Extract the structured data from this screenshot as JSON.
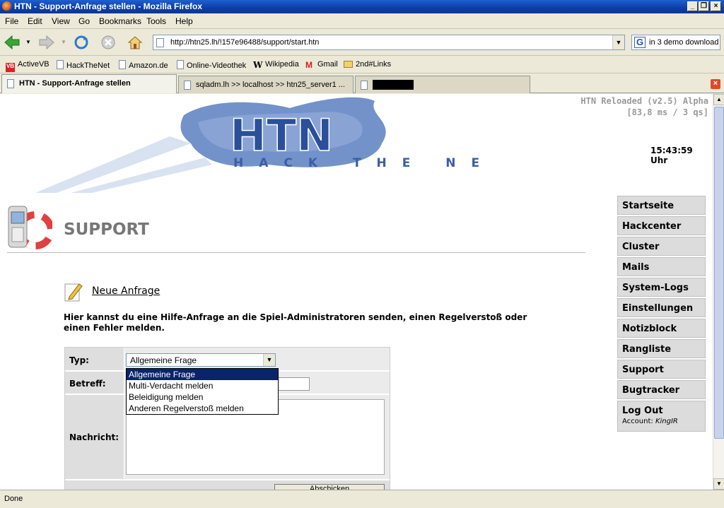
{
  "window": {
    "title": "HTN - Support-Anfrage stellen - Mozilla Firefox"
  },
  "menu": [
    "File",
    "Edit",
    "View",
    "Go",
    "Bookmarks",
    "Tools",
    "Help"
  ],
  "nav": {
    "url": "http://htn25.lh/!157e96488/support/start.htn",
    "search": "in 3 demo download"
  },
  "bookmarks": [
    "ActiveVB",
    "HackTheNet",
    "Amazon.de",
    "Online-Videothek",
    "Wikipedia",
    "Gmail",
    "2nd#Links"
  ],
  "tabs": [
    "HTN - Support-Anfrage stellen",
    "sqladm.lh >> localhost >> htn25_server1 ...",
    ""
  ],
  "page": {
    "logo_text": "HTN",
    "logo_sub": "HACK THE NET",
    "version": "HTN Reloaded (v2.5) Alpha",
    "timing": "[83,8 ms / 3 qs]",
    "clock": "15:43:59 Uhr",
    "heading": "SUPPORT",
    "new_request": "Neue Anfrage",
    "intro": "Hier kannst du eine Hilfe-Anfrage an die Spiel-Administratoren senden, einen Regelverstoß oder einen Fehler melden.",
    "form": {
      "typ_label": "Typ:",
      "betreff_label": "Betreff:",
      "nachricht_label": "Nachricht:",
      "typ_selected": "Allgemeine Frage",
      "typ_options": [
        "Allgemeine Frage",
        "Multi-Verdacht melden",
        "Beleidigung melden",
        "Anderen Regelverstoß melden"
      ],
      "submit_partial": "Abschicken"
    },
    "sidenav": [
      "Startseite",
      "Hackcenter",
      "Cluster",
      "Mails",
      "System-Logs",
      "Einstellungen",
      "Notizblock",
      "Rangliste",
      "Support",
      "Bugtracker"
    ],
    "logout": "Log Out",
    "account_label": "Account:",
    "account_name": "KingIR"
  },
  "status": "Done"
}
